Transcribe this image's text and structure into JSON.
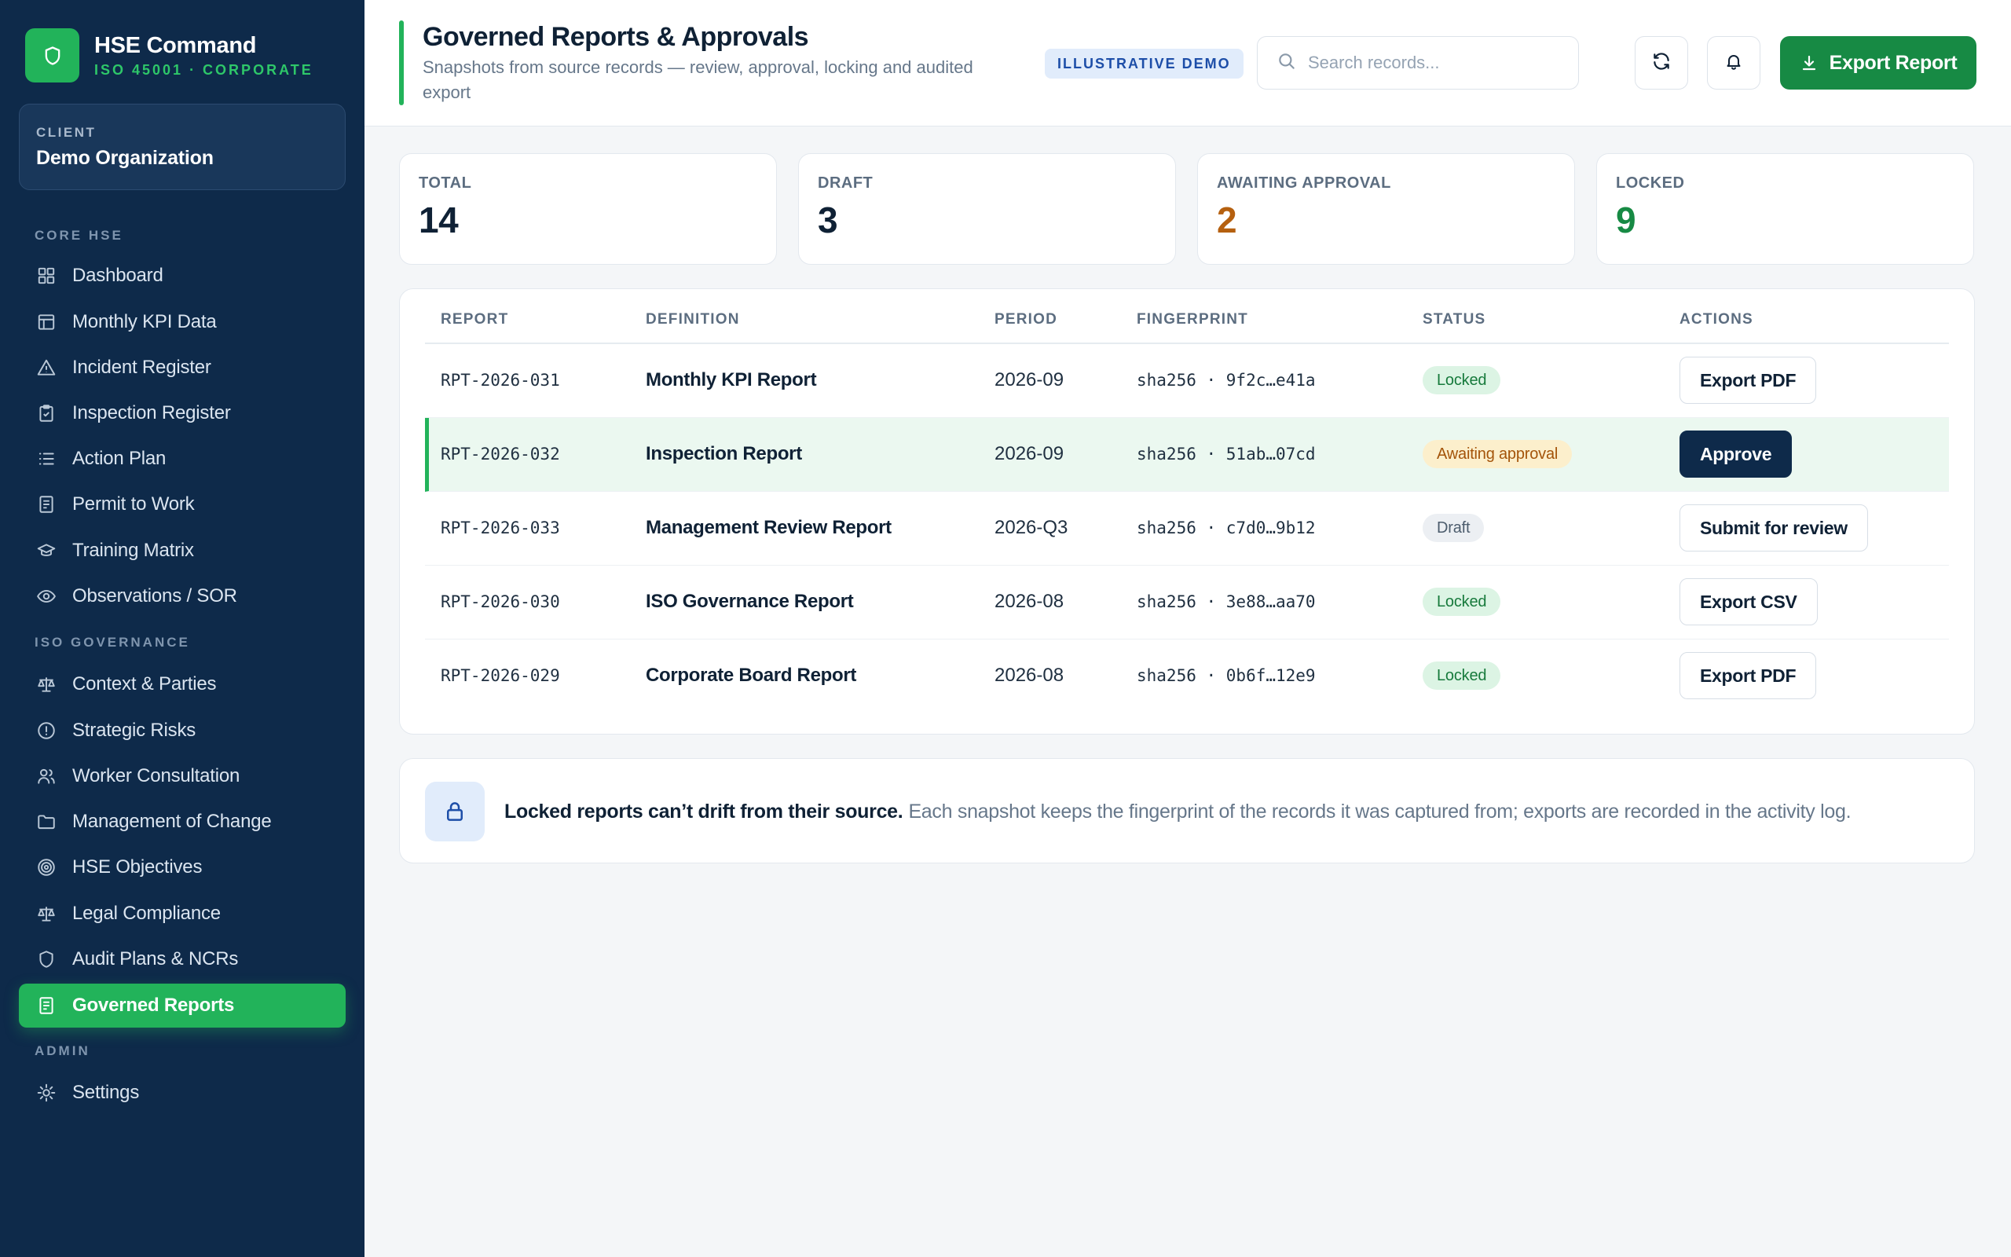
{
  "app": {
    "title": "HSE Command",
    "subtitle": "ISO 45001 · CORPORATE"
  },
  "client": {
    "label": "CLIENT",
    "name": "Demo Organization"
  },
  "sidebar": {
    "sections": [
      {
        "title": "CORE HSE",
        "items": [
          {
            "label": "Dashboard",
            "icon": "grid-icon"
          },
          {
            "label": "Monthly KPI Data",
            "icon": "table-icon"
          },
          {
            "label": "Incident Register",
            "icon": "warning-icon"
          },
          {
            "label": "Inspection Register",
            "icon": "clipboard-check-icon"
          },
          {
            "label": "Action Plan",
            "icon": "list-icon"
          },
          {
            "label": "Permit to Work",
            "icon": "document-icon"
          },
          {
            "label": "Training Matrix",
            "icon": "graduation-cap-icon"
          },
          {
            "label": "Observations / SOR",
            "icon": "eye-icon"
          }
        ]
      },
      {
        "title": "ISO GOVERNANCE",
        "items": [
          {
            "label": "Context & Parties",
            "icon": "scale-icon"
          },
          {
            "label": "Strategic Risks",
            "icon": "alert-circle-icon"
          },
          {
            "label": "Worker Consultation",
            "icon": "users-icon"
          },
          {
            "label": "Management of Change",
            "icon": "folder-icon"
          },
          {
            "label": "HSE Objectives",
            "icon": "target-icon"
          },
          {
            "label": "Legal Compliance",
            "icon": "scale-icon"
          },
          {
            "label": "Audit Plans & NCRs",
            "icon": "shield-icon"
          },
          {
            "label": "Governed Reports",
            "icon": "document-icon",
            "active": true
          }
        ]
      },
      {
        "title": "ADMIN",
        "items": [
          {
            "label": "Settings",
            "icon": "gear-icon"
          }
        ]
      }
    ]
  },
  "header": {
    "title": "Governed Reports & Approvals",
    "subtitle": "Snapshots from source records — review, approval, locking and audited export",
    "badge": "ILLUSTRATIVE DEMO",
    "search_placeholder": "Search records...",
    "export_label": "Export Report"
  },
  "stats": [
    {
      "label": "TOTAL",
      "value": "14",
      "color": "#0f2135"
    },
    {
      "label": "DRAFT",
      "value": "3",
      "color": "#0f2135"
    },
    {
      "label": "AWAITING APPROVAL",
      "value": "2",
      "color": "#b5600f"
    },
    {
      "label": "LOCKED",
      "value": "9",
      "color": "#178a44"
    }
  ],
  "table": {
    "columns": [
      "REPORT",
      "DEFINITION",
      "PERIOD",
      "FINGERPRINT",
      "STATUS",
      "ACTIONS"
    ],
    "rows": [
      {
        "id": "RPT-2026-031",
        "definition": "Monthly KPI Report",
        "period": "2026-09",
        "fingerprint": "sha256 · 9f2c…e41a",
        "status": "Locked",
        "status_kind": "locked",
        "action": "Export PDF",
        "action_kind": "secondary"
      },
      {
        "id": "RPT-2026-032",
        "definition": "Inspection Report",
        "period": "2026-09",
        "fingerprint": "sha256 · 51ab…07cd",
        "status": "Awaiting approval",
        "status_kind": "awaiting",
        "action": "Approve",
        "action_kind": "primary",
        "highlight": true
      },
      {
        "id": "RPT-2026-033",
        "definition": "Management Review Report",
        "period": "2026-Q3",
        "fingerprint": "sha256 · c7d0…9b12",
        "status": "Draft",
        "status_kind": "draft",
        "action": "Submit for review",
        "action_kind": "secondary"
      },
      {
        "id": "RPT-2026-030",
        "definition": "ISO Governance Report",
        "period": "2026-08",
        "fingerprint": "sha256 · 3e88…aa70",
        "status": "Locked",
        "status_kind": "locked",
        "action": "Export CSV",
        "action_kind": "secondary"
      },
      {
        "id": "RPT-2026-029",
        "definition": "Corporate Board Report",
        "period": "2026-08",
        "fingerprint": "sha256 · 0b6f…12e9",
        "status": "Locked",
        "status_kind": "locked",
        "action": "Export PDF",
        "action_kind": "secondary"
      }
    ]
  },
  "info": {
    "strong": "Locked reports can’t drift from their source.",
    "text": "Each snapshot keeps the fingerprint of the records it was captured from; exports are recorded in the activity log."
  },
  "colors": {
    "sidebar_bg": "#0e2a4a",
    "accent_green": "#22b35a",
    "export_green": "#178a44",
    "awaiting_orange": "#b5600f"
  }
}
